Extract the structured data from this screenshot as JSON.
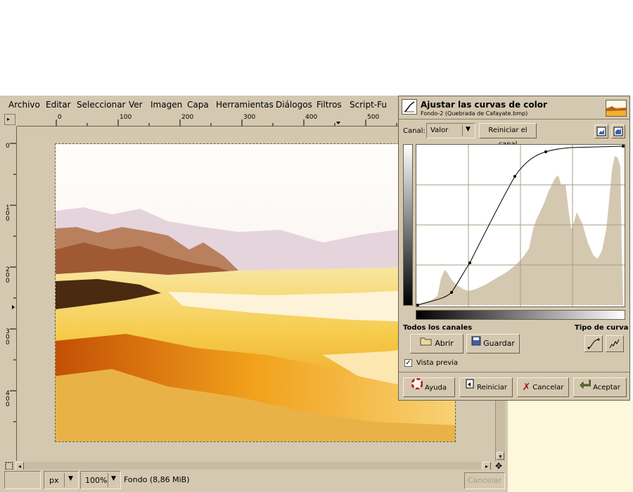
{
  "menubar": {
    "items": [
      "Archivo",
      "Editar",
      "Seleccionar",
      "Ver",
      "Imagen",
      "Capa",
      "Herramientas",
      "Diálogos",
      "Filtros",
      "Script-Fu"
    ]
  },
  "rulers": {
    "horizontal": [
      "0",
      "100",
      "200",
      "300",
      "400",
      "500"
    ],
    "vertical": [
      "0",
      "100",
      "200",
      "300",
      "400"
    ]
  },
  "statusbar": {
    "unit": "px",
    "zoom": "100%",
    "layer_info": "Fondo (8,86 MiB)",
    "cancel_label": "Cancelar"
  },
  "dialog": {
    "title": "Ajustar las curvas de color",
    "subtitle": "Fondo-2 (Quebrada de Cafayate.bmp)",
    "channel_label": "Canal:",
    "channel_value": "Valor",
    "reset_channel_label": "Reiniciar el canal",
    "all_channels_label": "Todos los canales",
    "curve_type_label": "Tipo de curva",
    "open_label": "Abrir",
    "save_label": "Guardar",
    "preview_label": "Vista previa",
    "preview_checked": true,
    "help_label": "Ayuda",
    "reset_label": "Reiniciar",
    "cancel_label": "Cancelar",
    "accept_label": "Aceptar"
  },
  "icons": {
    "curves_tool": "curves-icon",
    "linear_histogram": "linear-histogram-icon",
    "log_histogram": "log-histogram-icon",
    "smooth_curve": "smooth-curve-icon",
    "freehand_curve": "freehand-curve-icon"
  }
}
